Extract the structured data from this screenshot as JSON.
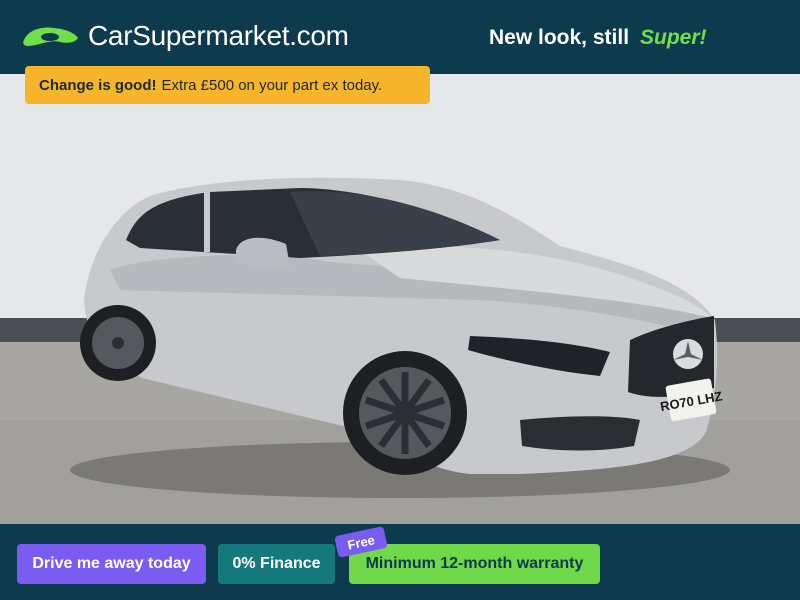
{
  "header": {
    "logo_text": "CarSupermarket.com",
    "logo_icon": "car-silhouette-icon",
    "tagline": "New look, still",
    "tagline_accent": "Super!"
  },
  "promo": {
    "bold": "Change is good!",
    "text": "Extra £500 on your part ex today."
  },
  "photo": {
    "plate": "RO70 LHZ"
  },
  "footer": {
    "drive": "Drive me away today",
    "finance": "0% Finance",
    "free_badge": "Free",
    "warranty": "Minimum 12-month warranty"
  },
  "colors": {
    "brand_navy": "#0d3a4c",
    "accent_green": "#6fe04a",
    "promo_yellow": "#f7b52b",
    "purple": "#7a5cf0",
    "teal": "#15787a"
  }
}
